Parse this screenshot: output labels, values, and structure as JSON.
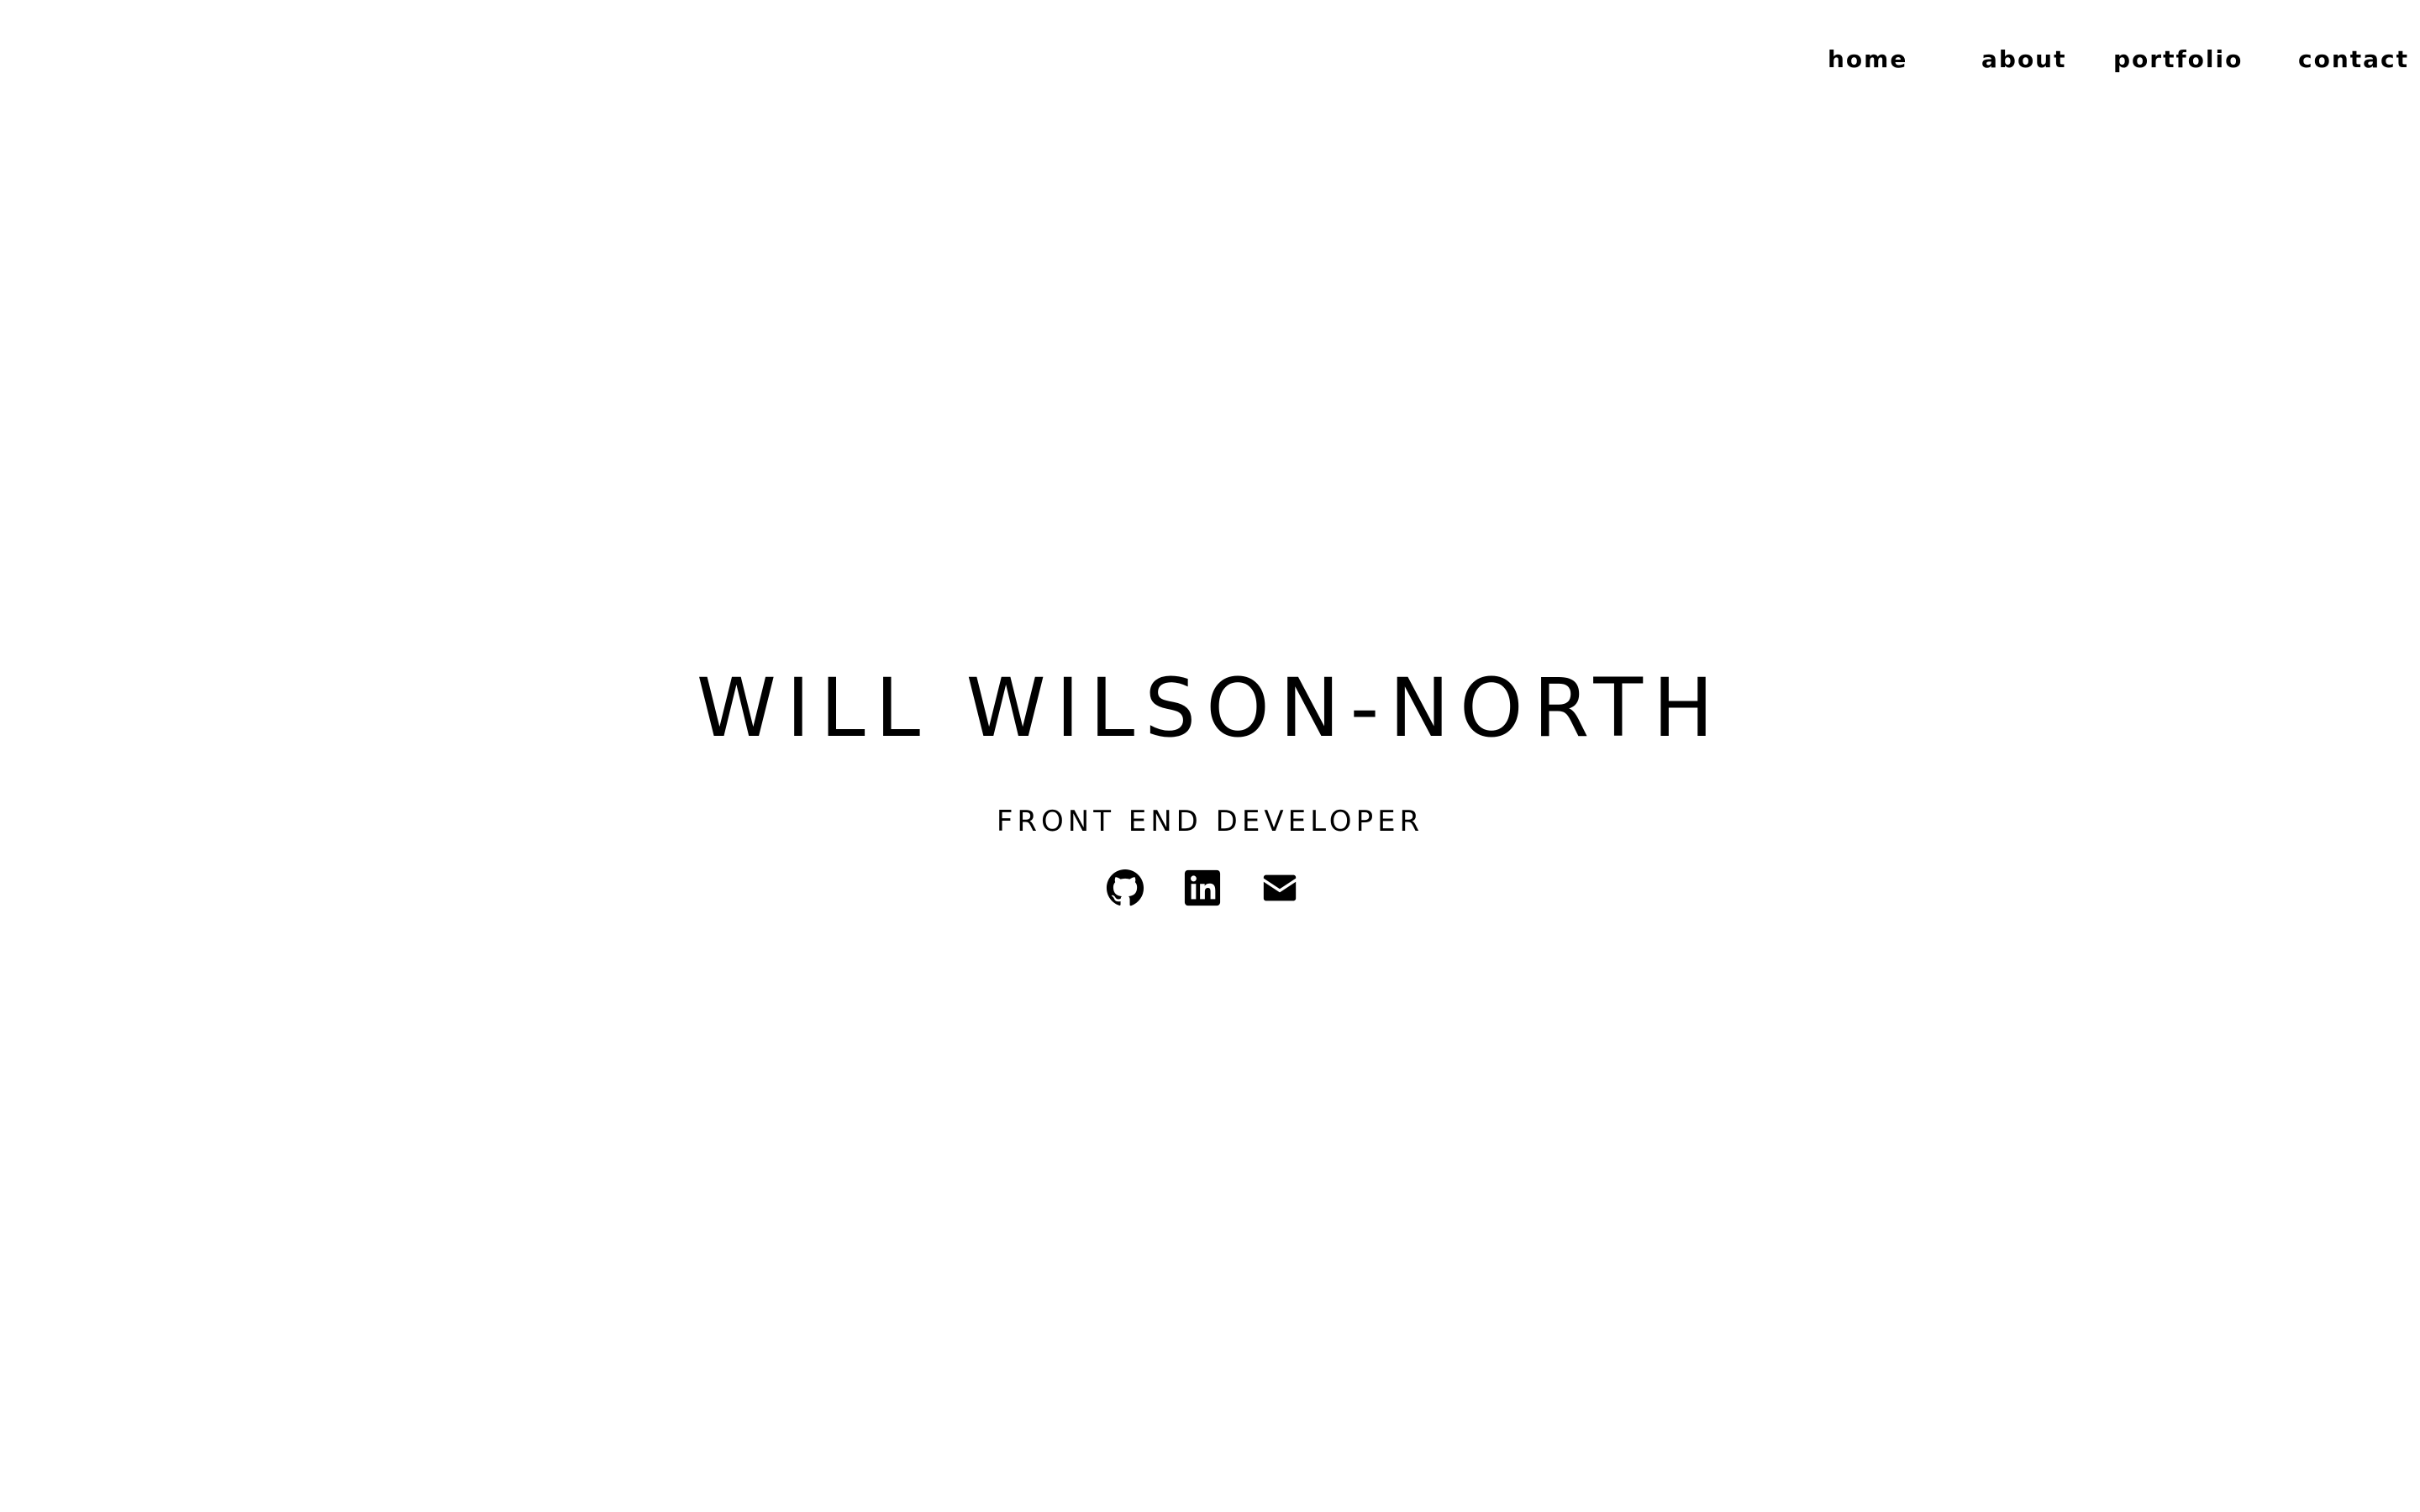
{
  "nav": {
    "items": [
      {
        "label": "home"
      },
      {
        "label": "about"
      },
      {
        "label": "portfolio"
      },
      {
        "label": "contact"
      }
    ]
  },
  "hero": {
    "name": "WILL WILSON-NORTH",
    "role": "FRONT END DEVELOPER"
  },
  "social": {
    "icons": [
      "github-icon",
      "linkedin-icon",
      "email-icon"
    ]
  },
  "colors": {
    "background": "#ffffff",
    "text": "#000000"
  }
}
